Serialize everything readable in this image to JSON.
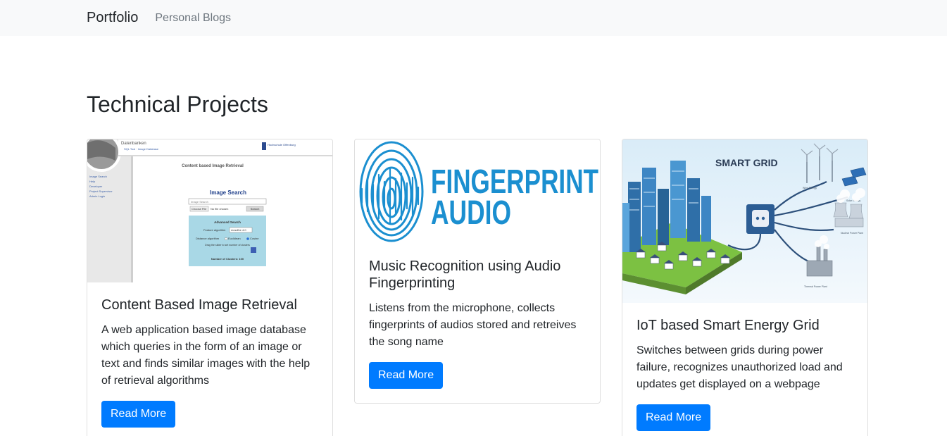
{
  "nav": {
    "brand": "Portfolio",
    "link": "Personal Blogs"
  },
  "page": {
    "title": "Technical Projects"
  },
  "cards": [
    {
      "title": "Content Based Image Retrieval",
      "text": "A web application based image database which queries in the form of an image or text and finds similar images with the help of retrieval algorithms",
      "button": "Read More",
      "image": {
        "header_text": "Datenbanken",
        "subheader_text": "SQL Tool · Image Database",
        "university": "Hochschule Offenburg",
        "heading": "Content based Image Retrieval",
        "search_title": "Image Search",
        "search_placeholder": "Image Search",
        "file_button": "Choose File",
        "file_status": "No file chosen",
        "search_button": "Search",
        "advanced_title": "Advanced Search",
        "feature_label": "Feature algorithm",
        "feature_value": "mcsdfve 4.0",
        "distance_label": "Distance algorithm",
        "euclidean": "Euclidean",
        "cosine": "Cosine",
        "drag_hint": "Drag the slider to set number of clusters",
        "clusters_label": "Number of Clusters: 100",
        "sidebar": [
          "Image Search",
          "Help",
          "Developer",
          "Project Supervisor",
          "Admin Login"
        ]
      }
    },
    {
      "title": "Music Recognition using Audio Fingerprinting",
      "text": "Listens from the microphone, collects fingerprints of audios stored and retreives the song name",
      "button": "Read More",
      "image": {
        "line1": "FINGERPRINT",
        "line2": "AUDIO"
      }
    },
    {
      "title": "IoT based Smart Energy Grid",
      "text": "Switches between grids during power failure, recognizes unauthorized load and updates get displayed on a webpage",
      "button": "Read More",
      "image": {
        "title": "SMART GRID",
        "labels": [
          "Wind Energy",
          "Solar Energy",
          "Nuclear Power Plant",
          "Thermal Power Plant"
        ]
      }
    }
  ],
  "colors": {
    "primary": "#007bff",
    "navbar_bg": "#f8f9fa",
    "fingerprint_blue": "#1b8fd0"
  }
}
